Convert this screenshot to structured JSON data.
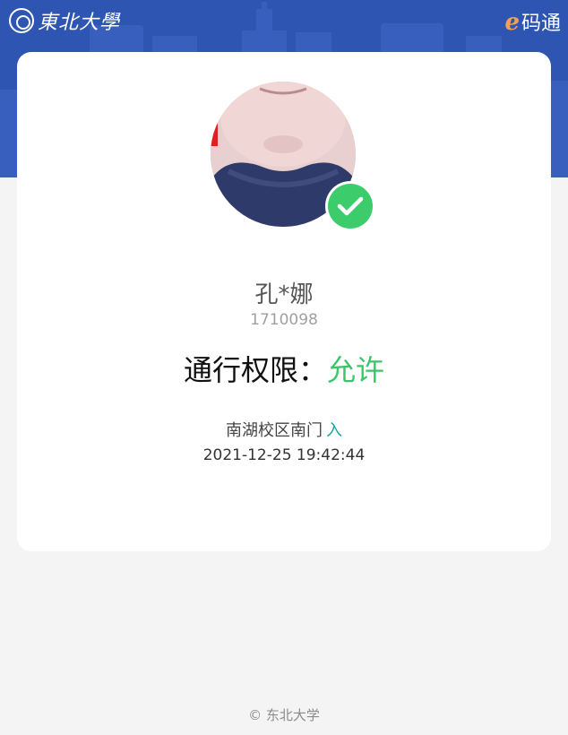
{
  "header": {
    "logo_text": "東北大學",
    "brand_letter": "e",
    "brand_text": "码通"
  },
  "card": {
    "name": "孔*娜",
    "student_id": "1710098",
    "permission_label": "通行权限：",
    "permission_status": "允许",
    "location": "南湖校区南门",
    "direction": "入",
    "timestamp": "2021-12-25 19:42:44"
  },
  "footer": {
    "copyright": "© 东北大学"
  },
  "colors": {
    "header_bg": "#2f55b3",
    "accent_green": "#3cc468",
    "direction_teal": "#1aa39a",
    "brand_orange": "#f2a154"
  },
  "icons": {
    "verified": "check-circle-icon"
  }
}
